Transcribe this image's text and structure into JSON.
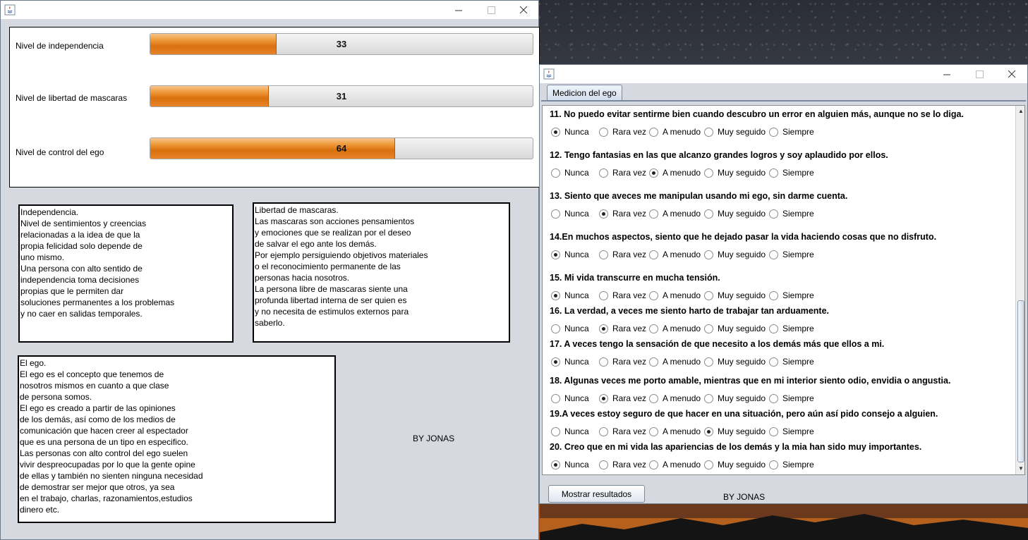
{
  "window1": {
    "meters": [
      {
        "label": "Nivel de independencia",
        "value": 33,
        "text": "33"
      },
      {
        "label": "Nivel de libertad de mascaras",
        "value": 31,
        "text": "31"
      },
      {
        "label": "Nivel de control del ego",
        "value": 64,
        "text": "64"
      }
    ],
    "texts": {
      "independencia": "Independencia.\nNivel de sentimientos y creencias\nrelacionadas a la idea de que la\npropia felicidad solo depende de\nuno mismo.\nUna persona con alto sentido de\nindependencia toma decisiones\npropias que le permiten dar\nsoluciones permanentes a los problemas\ny no caer en salidas temporales.",
      "libertad": "Libertad de mascaras.\nLas mascaras son acciones pensamientos\ny emociones que se realizan por el deseo\nde salvar el ego ante los demás.\nPor ejemplo persiguiendo objetivos materiales\no el reconocimiento permanente de las\npersonas hacia nosotros.\nLa persona libre de mascaras siente una\nprofunda libertad interna de ser quien es\ny no necesita de estimulos externos para\nsaberlo.",
      "ego": "El ego.\nEl ego es el concepto que tenemos de\nnosotros mismos en cuanto a que clase\nde persona somos.\nEl ego es creado a partir de las opiniones\nde los demás, así como de los medios de\ncomunicación que hacen creer al espectador\nque es una persona de un tipo en especifico.\nLas personas con alto control del ego suelen\nvivir despreocupadas por lo que la gente opine\nde ellas y también no sienten ninguna necesidad\nde demostrar ser mejor que otros, ya sea\nen el trabajo, charlas, razonamientos,estudios\ndinero etc."
    },
    "by_label": "BY JONAS"
  },
  "window2": {
    "tab_label": "Medicion del ego",
    "options": [
      "Nunca",
      "Rara vez",
      "A menudo",
      "Muy seguido",
      "Siempre"
    ],
    "questions": [
      {
        "text": "11. No puedo evitar sentirme bien cuando descubro un error en alguien más, aunque no se lo diga.",
        "selected": 0
      },
      {
        "text": "12. Tengo fantasias en las que alcanzo grandes logros y soy aplaudido por ellos.",
        "selected": 2
      },
      {
        "text": "13. Siento que aveces me manipulan usando mi ego, sin darme cuenta.",
        "selected": 1
      },
      {
        "text": "14.En muchos aspectos, siento que he dejado pasar la vida haciendo cosas que no disfruto.",
        "selected": 0
      },
      {
        "text": "15. Mi vida transcurre en mucha tensión.",
        "selected": 0
      },
      {
        "text": "16. La verdad, a veces me siento harto de trabajar tan arduamente.",
        "selected": 1
      },
      {
        "text": "17. A veces tengo la sensación de que necesito a los demás más que ellos a mi.",
        "selected": 0
      },
      {
        "text": "18. Algunas veces me porto amable, mientras que en mi interior siento odio, envidia o angustia.",
        "selected": 1
      },
      {
        "text": "19.A veces estoy seguro de que hacer en una situación, pero aún así pido consejo a alguien.",
        "selected": 3
      },
      {
        "text": "20. Creo que en mi vida las apariencias de los demás y la mia han sido muy importantes.",
        "selected": 0
      }
    ],
    "button_label": "Mostrar resultados",
    "by_label": "BY JONAS"
  },
  "colors": {
    "progress_fill": "#e07a1c",
    "window_bg": "#d6d9df"
  }
}
